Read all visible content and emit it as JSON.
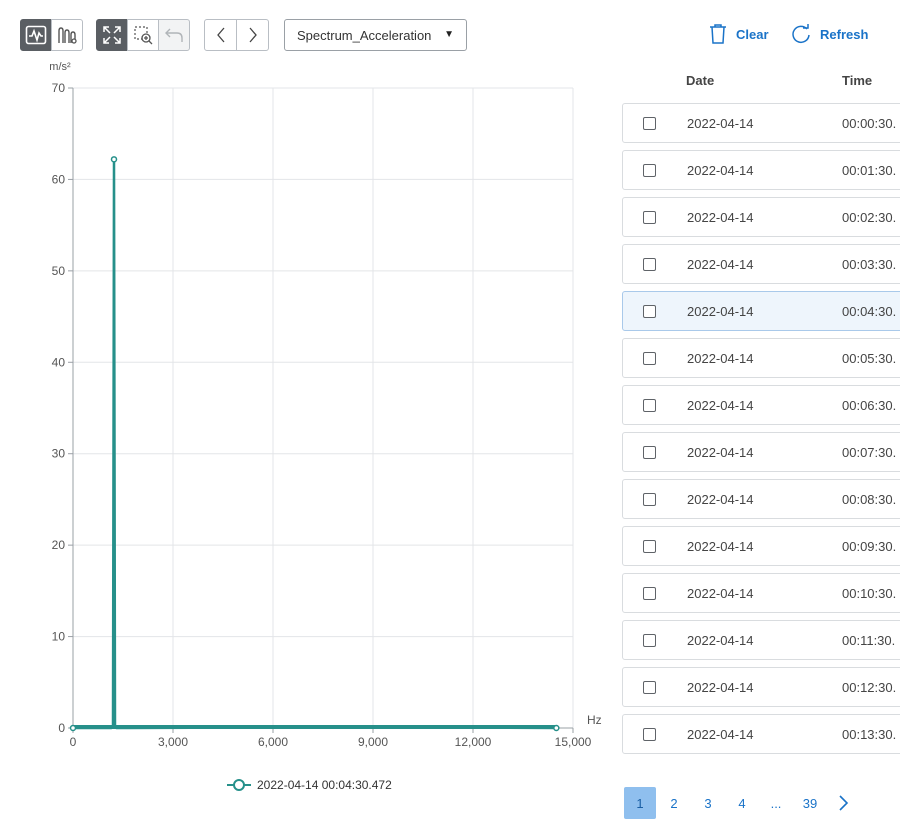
{
  "toolbar": {
    "view_icons": [
      "waveform-view-icon",
      "multi-channel-view-icon"
    ],
    "zoom_icons": [
      "fit-expand-icon",
      "zoom-region-icon",
      "undo-zoom-icon"
    ],
    "nav_icons": [
      "chevron-left-icon",
      "chevron-right-icon"
    ],
    "dropdown_value": "Spectrum_Acceleration",
    "clear_label": "Clear",
    "refresh_label": "Refresh"
  },
  "chart_data": {
    "type": "line",
    "ylabel": "m/s²",
    "xlabel": "Hz",
    "xlim": [
      0,
      15000
    ],
    "ylim": [
      0,
      70
    ],
    "x_ticks": [
      0,
      3000,
      6000,
      9000,
      12000,
      15000
    ],
    "x_tick_labels": [
      "0",
      "3,000",
      "6,000",
      "9,000",
      "12,000",
      "15,000"
    ],
    "y_ticks": [
      0,
      10,
      20,
      30,
      40,
      50,
      60,
      70
    ],
    "y_tick_labels": [
      "0",
      "10",
      "20",
      "30",
      "40",
      "50",
      "60",
      "70"
    ],
    "grid": true,
    "series": [
      {
        "name": "2022-04-14 00:04:30.472",
        "color": "#26908a",
        "points": [
          [
            0,
            0
          ],
          [
            1150,
            0
          ],
          [
            1200,
            0.3
          ],
          [
            1230,
            62.2
          ],
          [
            1260,
            0.3
          ],
          [
            1300,
            0
          ],
          [
            9900,
            0.1
          ],
          [
            14500,
            0
          ]
        ],
        "marker_points": [
          [
            0,
            0
          ],
          [
            1230,
            62.2
          ],
          [
            14500,
            0
          ]
        ]
      }
    ],
    "legend_position": "bottom"
  },
  "table": {
    "headers": {
      "date": "Date",
      "time": "Time"
    },
    "rows": [
      {
        "date": "2022-04-14",
        "time": "00:00:30.",
        "selected": false
      },
      {
        "date": "2022-04-14",
        "time": "00:01:30.",
        "selected": false
      },
      {
        "date": "2022-04-14",
        "time": "00:02:30.",
        "selected": false
      },
      {
        "date": "2022-04-14",
        "time": "00:03:30.",
        "selected": false
      },
      {
        "date": "2022-04-14",
        "time": "00:04:30.",
        "selected": true
      },
      {
        "date": "2022-04-14",
        "time": "00:05:30.",
        "selected": false
      },
      {
        "date": "2022-04-14",
        "time": "00:06:30.",
        "selected": false
      },
      {
        "date": "2022-04-14",
        "time": "00:07:30.",
        "selected": false
      },
      {
        "date": "2022-04-14",
        "time": "00:08:30.",
        "selected": false
      },
      {
        "date": "2022-04-14",
        "time": "00:09:30.",
        "selected": false
      },
      {
        "date": "2022-04-14",
        "time": "00:10:30.",
        "selected": false
      },
      {
        "date": "2022-04-14",
        "time": "00:11:30.",
        "selected": false
      },
      {
        "date": "2022-04-14",
        "time": "00:12:30.",
        "selected": false
      },
      {
        "date": "2022-04-14",
        "time": "00:13:30.",
        "selected": false
      }
    ]
  },
  "pagination": {
    "pages": [
      "1",
      "2",
      "3",
      "4",
      "...",
      "39"
    ],
    "current": "1",
    "next_icon": "chevron-right-icon"
  },
  "colors": {
    "accent": "#1a73c8",
    "series": "#26908a",
    "toolbar_active": "#5a5e63"
  }
}
